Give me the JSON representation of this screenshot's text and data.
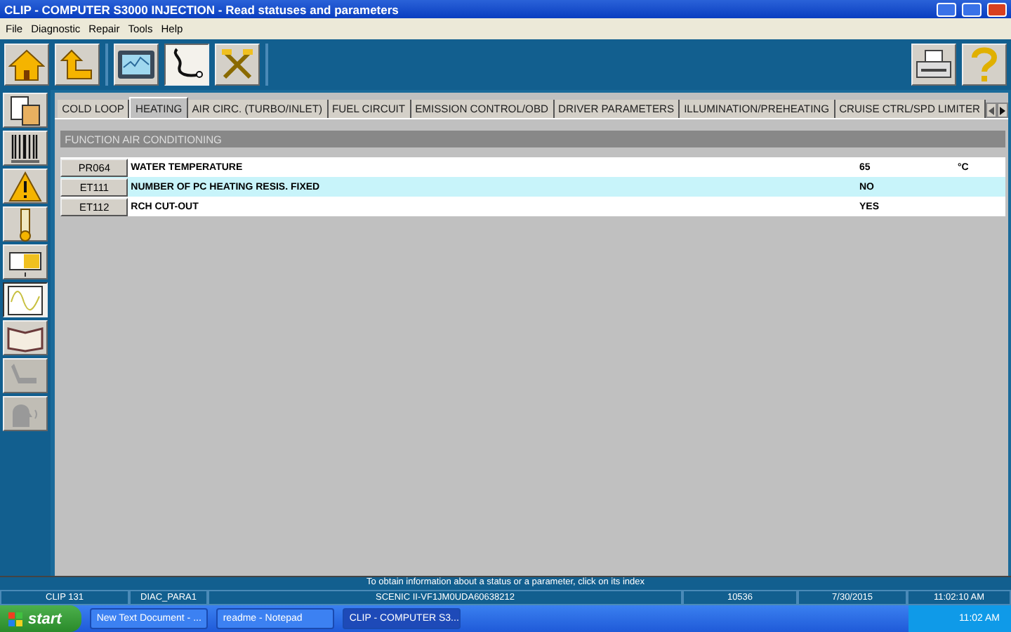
{
  "window": {
    "title": "CLIP - COMPUTER S3000 INJECTION - Read statuses and parameters"
  },
  "menu": [
    "File",
    "Diagnostic",
    "Repair",
    "Tools",
    "Help"
  ],
  "toolbar": {
    "left": [
      {
        "kind": "home",
        "selected": false
      },
      {
        "kind": "back",
        "selected": false
      },
      {
        "kind": "screen",
        "selected": false
      },
      {
        "kind": "probe",
        "selected": true
      },
      {
        "kind": "tools",
        "selected": false
      }
    ],
    "right": [
      {
        "kind": "printer"
      },
      {
        "kind": "help"
      }
    ]
  },
  "sidebar": [
    {
      "kind": "documents",
      "selected": false,
      "disabled": false
    },
    {
      "kind": "barcode",
      "selected": false,
      "disabled": false
    },
    {
      "kind": "warning",
      "selected": false,
      "disabled": false
    },
    {
      "kind": "thermometer",
      "selected": false,
      "disabled": false
    },
    {
      "kind": "actuator",
      "selected": false,
      "disabled": false
    },
    {
      "kind": "graph",
      "selected": true,
      "disabled": false
    },
    {
      "kind": "book",
      "selected": false,
      "disabled": false
    },
    {
      "kind": "seat",
      "selected": false,
      "disabled": true
    },
    {
      "kind": "voice",
      "selected": false,
      "disabled": true
    }
  ],
  "tabs": [
    {
      "label": "COLD LOOP",
      "selected": false
    },
    {
      "label": "HEATING",
      "selected": true
    },
    {
      "label": "AIR CIRC. (TURBO/INLET)",
      "selected": false
    },
    {
      "label": "FUEL CIRCUIT",
      "selected": false
    },
    {
      "label": "EMISSION CONTROL/OBD",
      "selected": false
    },
    {
      "label": "DRIVER PARAMETERS",
      "selected": false
    },
    {
      "label": "ILLUMINATION/PREHEATING",
      "selected": false
    },
    {
      "label": "CRUISE CTRL/SPD LIMITER",
      "selected": false
    }
  ],
  "section": {
    "title": "FUNCTION AIR CONDITIONING"
  },
  "rows": [
    {
      "index": "PR064",
      "name": "WATER TEMPERATURE",
      "value": "65",
      "unit": "°C",
      "selected": false
    },
    {
      "index": "ET111",
      "name": "NUMBER OF PC HEATING RESIS. FIXED",
      "value": "NO",
      "selected": true
    },
    {
      "index": "ET112",
      "name": "RCH CUT-OUT",
      "value": "YES",
      "selected": false
    }
  ],
  "hint": "To obtain information about a status or a parameter, click on its index",
  "status_bar": [
    "CLIP 131",
    "DIAC_PARA1",
    "SCENIC II-VF1JM0UDA60638212",
    "10536",
    "7/30/2015",
    "11:02:10 AM"
  ],
  "taskbar": {
    "start": "start",
    "tasks": [
      {
        "label": "New Text Document - ...",
        "selected": false
      },
      {
        "label": "readme - Notepad",
        "selected": false
      },
      {
        "label": "CLIP - COMPUTER S3...",
        "selected": true
      }
    ],
    "clock": "11:02 AM"
  }
}
